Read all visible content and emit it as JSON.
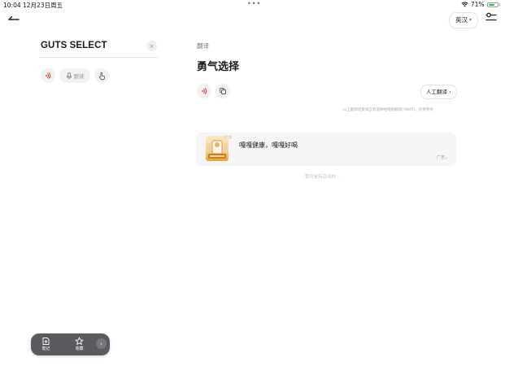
{
  "status_bar": {
    "time": "10:04",
    "date": "12月23日周五",
    "dots": "•••",
    "battery_percent": "71%",
    "battery_level": 0.71
  },
  "top_bar": {
    "language": "英汉",
    "language_chevron": "▾"
  },
  "query": {
    "text": "GUTS SELECT",
    "clear_symbol": "×",
    "follow_read_label": "跟读"
  },
  "result": {
    "section_label": "翻译",
    "translation": "勇气选择",
    "human_translate_label": "人工翻译 ›",
    "disclaimer": "以上翻译结果来自有道神经网络翻译(YNMT)，仅供参考"
  },
  "ad": {
    "thumb_caption": "广告",
    "text": "嘎嘎健康，嘎嘎好喝",
    "badge": "广告⌄"
  },
  "end_note": "- 我可是有底线的 -",
  "bottom_bar": {
    "notes_label": "笔记",
    "favorites_label": "收藏",
    "more_symbol": "›"
  },
  "colors": {
    "accent_red": "#e8463c",
    "battery_green": "#29c04f",
    "bottom_bar_bg": "#5a5b60"
  },
  "icons": {
    "back": "back-arrow-icon",
    "settings": "settings-sliders-icon",
    "speaker": "speaker-icon",
    "mic": "microphone-icon",
    "hand": "hand-pointer-icon",
    "copy": "copy-icon",
    "notes": "note-add-icon",
    "star": "star-icon"
  }
}
